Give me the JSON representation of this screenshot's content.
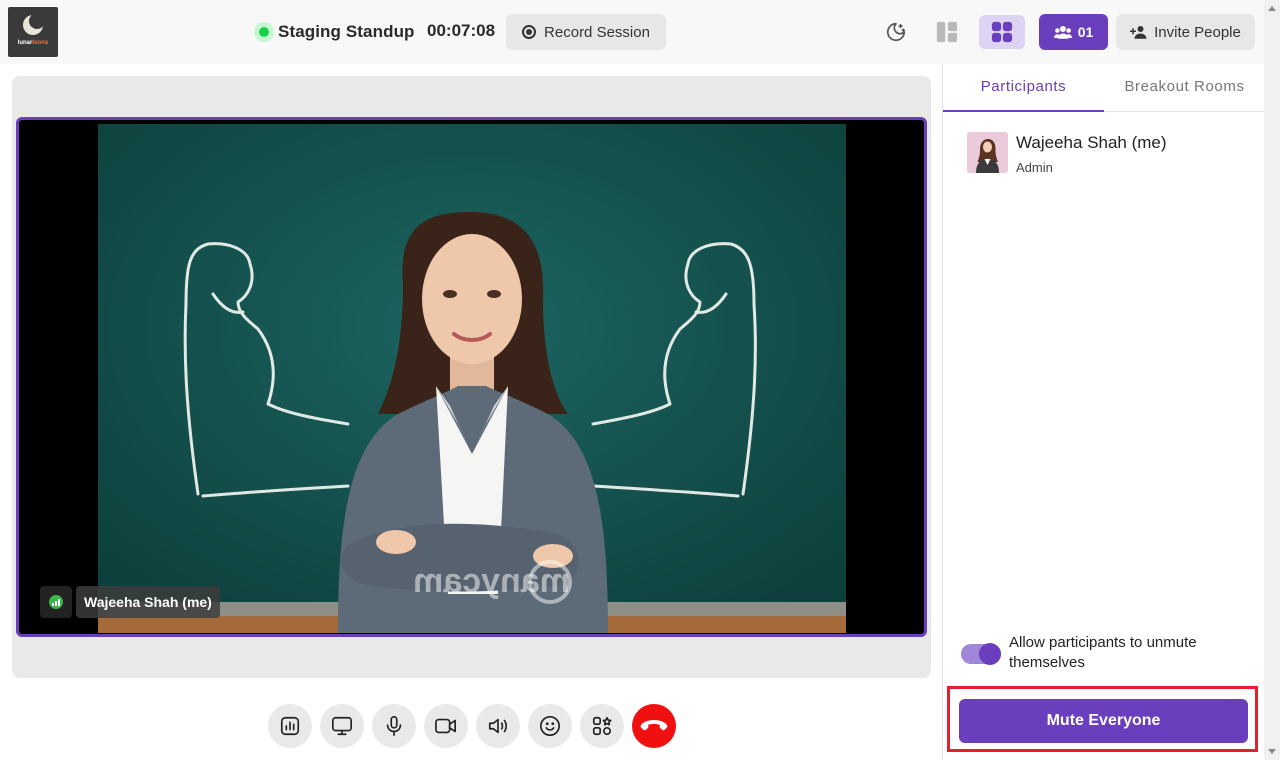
{
  "header": {
    "logo_text_a": "lunar",
    "logo_text_b": "loons",
    "session_title": "Staging Standup",
    "timer": "00:07:08",
    "record_label": "Record Session",
    "participant_count": "01",
    "invite_label": "Invite People"
  },
  "stage": {
    "video_name": "Wajeeha Shah (me)",
    "watermark": "manycam"
  },
  "controls": [
    "stats",
    "screen-share",
    "microphone",
    "camera",
    "speaker",
    "reactions",
    "apps",
    "end-call"
  ],
  "panel": {
    "tabs": [
      "Participants",
      "Breakout Rooms"
    ],
    "active_tab": "Participants",
    "participants": [
      {
        "name": "Wajeeha Shah (me)",
        "role": "Admin"
      }
    ],
    "allow_unmute_label": "Allow participants to unmute themselves",
    "allow_unmute_enabled": true,
    "mute_all_label": "Mute Everyone"
  },
  "colors": {
    "accent": "#6a3fbd",
    "live": "#19d24b",
    "end_call": "#f01010",
    "highlight": "#e5202c"
  }
}
